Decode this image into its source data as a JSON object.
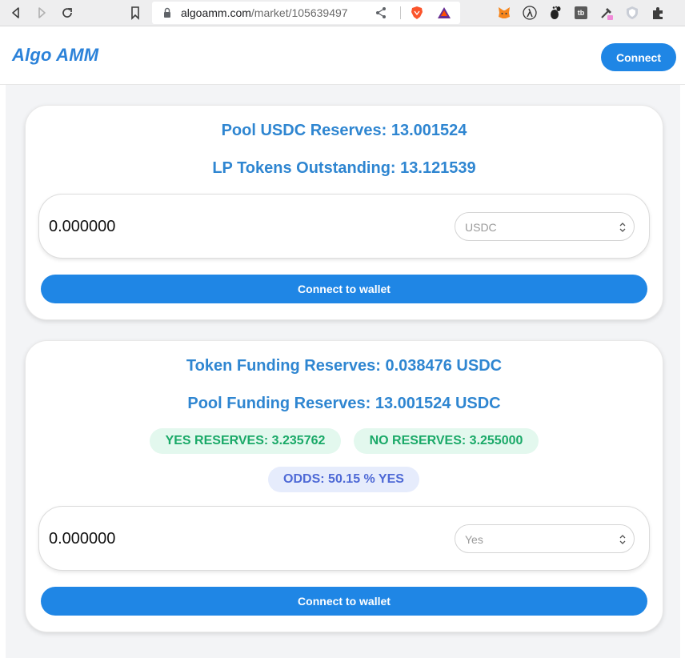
{
  "browser": {
    "url_domain": "algoamm.com",
    "url_path": "/market/105639497",
    "extensions": [
      "metamask-icon",
      "lambda-icon",
      "gnome-icon",
      "tb-icon",
      "tool-icon",
      "shield-icon",
      "puzzle-icon"
    ],
    "tb_text": "tb"
  },
  "header": {
    "brand": "Algo AMM",
    "connect_label": "Connect"
  },
  "liquidity": {
    "pool_reserves": "Pool USDC Reserves: 13.001524",
    "lp_outstanding": "LP Tokens Outstanding: 13.121539",
    "amount": "0.000000",
    "token_select": "USDC",
    "button_label": "Connect to wallet"
  },
  "trade": {
    "token_funding": "Token Funding Reserves: 0.038476 USDC",
    "pool_funding": "Pool Funding Reserves: 13.001524 USDC",
    "yes_reserves": "YES RESERVES: 3.235762",
    "no_reserves": "NO RESERVES: 3.255000",
    "odds": "ODDS: 50.15 % YES",
    "amount": "0.000000",
    "outcome_select": "Yes",
    "button_label": "Connect to wallet"
  },
  "colors": {
    "accent": "#1f86e5",
    "stat_text": "#2f86d1",
    "green_text": "#1aa968",
    "green_bg": "#e3f8ee",
    "odds_text": "#4f6ad6",
    "odds_bg": "#e6ecfc"
  }
}
